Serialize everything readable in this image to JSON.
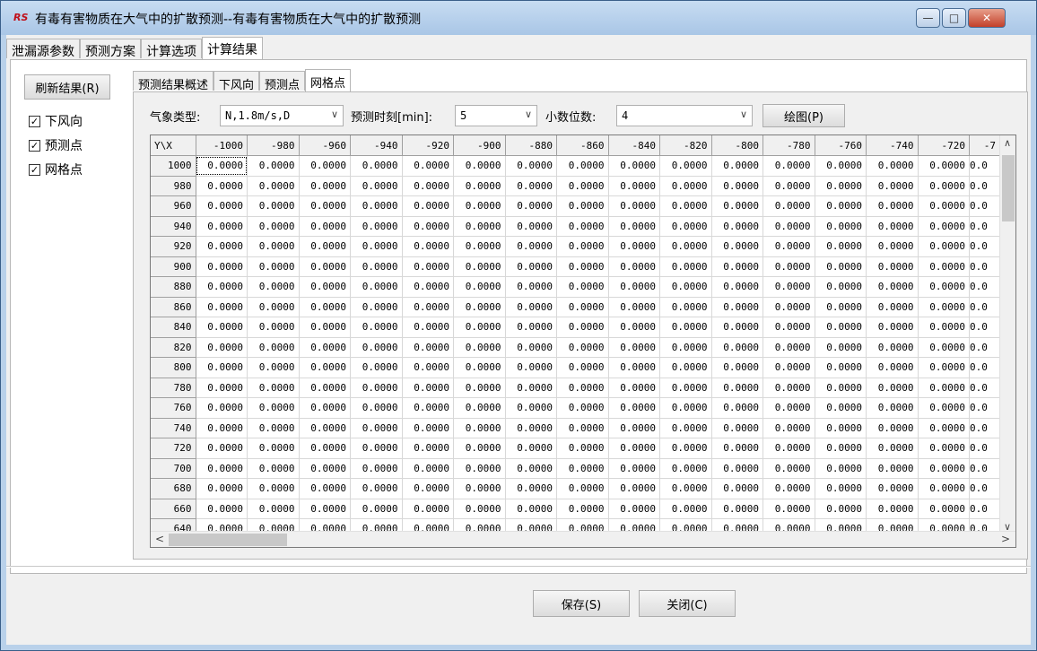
{
  "window": {
    "title": "有毒有害物质在大气中的扩散预测--有毒有害物质在大气中的扩散预测",
    "app_icon": "RS"
  },
  "top_tabs": [
    {
      "label": "泄漏源参数",
      "active": false
    },
    {
      "label": "预测方案",
      "active": false
    },
    {
      "label": "计算选项",
      "active": false
    },
    {
      "label": "计算结果",
      "active": true
    }
  ],
  "left": {
    "refresh_label": "刷新结果(R)",
    "checks": [
      {
        "label": "下风向",
        "checked": true
      },
      {
        "label": "预测点",
        "checked": true
      },
      {
        "label": "网格点",
        "checked": true
      }
    ]
  },
  "sub_tabs": [
    {
      "label": "预测结果概述",
      "active": false
    },
    {
      "label": "下风向",
      "active": false
    },
    {
      "label": "预测点",
      "active": false
    },
    {
      "label": "网格点",
      "active": true
    }
  ],
  "filters": {
    "weather_label": "气象类型:",
    "weather_value": "N,1.8m/s,D",
    "time_label": "预测时刻[min]:",
    "time_value": "5",
    "decimals_label": "小数位数:",
    "decimals_value": "4",
    "plot_label": "绘图(P)"
  },
  "grid": {
    "corner": "Y\\X",
    "columns": [
      "-1000",
      "-980",
      "-960",
      "-940",
      "-920",
      "-900",
      "-880",
      "-860",
      "-840",
      "-820",
      "-800",
      "-780",
      "-760",
      "-740",
      "-720",
      "-7"
    ],
    "rows": [
      "1000",
      "980",
      "960",
      "940",
      "920",
      "900",
      "880",
      "860",
      "840",
      "820",
      "800",
      "780",
      "760",
      "740",
      "720",
      "700",
      "680",
      "660",
      "640"
    ],
    "cell_value": "0.0000",
    "partial_cell_value": "0.0"
  },
  "footer": {
    "save_label": "保存(S)",
    "close_label": "关闭(C)"
  },
  "icons": {
    "minimize": "—",
    "maximize": "□",
    "close": "✕",
    "chevron": "∨",
    "check": "✓",
    "up": "∧",
    "down": "∨",
    "left": "<",
    "right": ">"
  }
}
